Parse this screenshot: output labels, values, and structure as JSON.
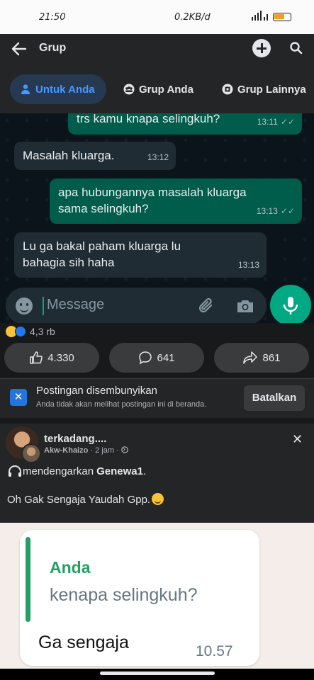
{
  "status_bar": {
    "time": "21:50",
    "network_speed": "0.2KB/d",
    "battery_color": "#f0a020"
  },
  "app_bar": {
    "back_icon": "arrow-left-icon",
    "title": "Grup",
    "add_icon": "plus-circle-icon",
    "search_icon": "search-icon"
  },
  "tabs": [
    {
      "label": "Untuk Anda",
      "icon": "person-icon",
      "active": true
    },
    {
      "label": "Grup Anda",
      "icon": "group-icon",
      "active": false
    },
    {
      "label": "Grup Lainnya",
      "icon": "compass-icon",
      "active": false
    }
  ],
  "chat": {
    "messages": [
      {
        "direction": "out",
        "text": "trs kamu knapa selingkuh?",
        "time": "13:11",
        "read": true
      },
      {
        "direction": "in",
        "text": "Masalah kluarga.",
        "time": "13:12"
      },
      {
        "direction": "out",
        "text": "apa hubungannya masalah kluarga sama selingkuh?",
        "time": "13:13",
        "read": true
      },
      {
        "direction": "in",
        "text": "Lu ga bakal paham kluarga lu bahagia sih haha",
        "time": "13:13"
      }
    ],
    "input_placeholder": "Message",
    "accent": "#00a884"
  },
  "reactions": {
    "count": "4,3 rb",
    "icons": [
      "haha-icon",
      "like-icon"
    ]
  },
  "actions": {
    "like_count": "4.330",
    "comment_count": "641",
    "share_count": "861"
  },
  "hidden_post": {
    "title": "Postingan disembunyikan",
    "subtitle": "Anda tidak akan melihat postingan ini di beranda.",
    "undo_label": "Batalkan"
  },
  "post": {
    "author": "terkadang....",
    "group": "Akw-Khaizo",
    "time": "2 jam",
    "listening_prefix": "mendengarkan",
    "listening_song": "Genewa1",
    "listening_suffix": ".",
    "text": "Oh Gak Sengaja Yaudah Gpp."
  },
  "image": {
    "quote_author": "Anda",
    "quoted_text": "kenapa selingkuh?",
    "reply_text": "Ga sengaja",
    "reply_time": "10.57"
  },
  "colors": {
    "facebook_blue": "#2374e1",
    "whatsapp_green": "#005c4b"
  }
}
